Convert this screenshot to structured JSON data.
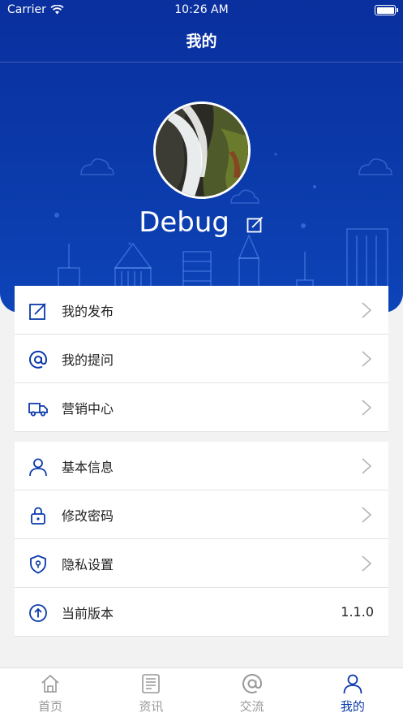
{
  "status_bar": {
    "carrier": "Carrier",
    "time": "10:26 AM"
  },
  "header": {
    "title": "我的"
  },
  "profile": {
    "username": "Debug"
  },
  "menu_group_1": [
    {
      "label": "我的发布",
      "icon": "edit-icon"
    },
    {
      "label": "我的提问",
      "icon": "at-icon"
    },
    {
      "label": "营销中心",
      "icon": "truck-icon"
    }
  ],
  "menu_group_2": [
    {
      "label": "基本信息",
      "icon": "user-icon"
    },
    {
      "label": "修改密码",
      "icon": "lock-icon"
    },
    {
      "label": "隐私设置",
      "icon": "shield-icon"
    },
    {
      "label": "当前版本",
      "icon": "upgrade-icon",
      "value": "1.1.0"
    }
  ],
  "tabs": [
    {
      "label": "首页",
      "icon": "home-icon",
      "active": false
    },
    {
      "label": "资讯",
      "icon": "news-icon",
      "active": false
    },
    {
      "label": "交流",
      "icon": "at-icon",
      "active": false
    },
    {
      "label": "我的",
      "icon": "person-icon",
      "active": true
    }
  ],
  "colors": {
    "primary": "#0b3aaa",
    "tab_inactive": "#999999",
    "background": "#f2f2f2"
  }
}
